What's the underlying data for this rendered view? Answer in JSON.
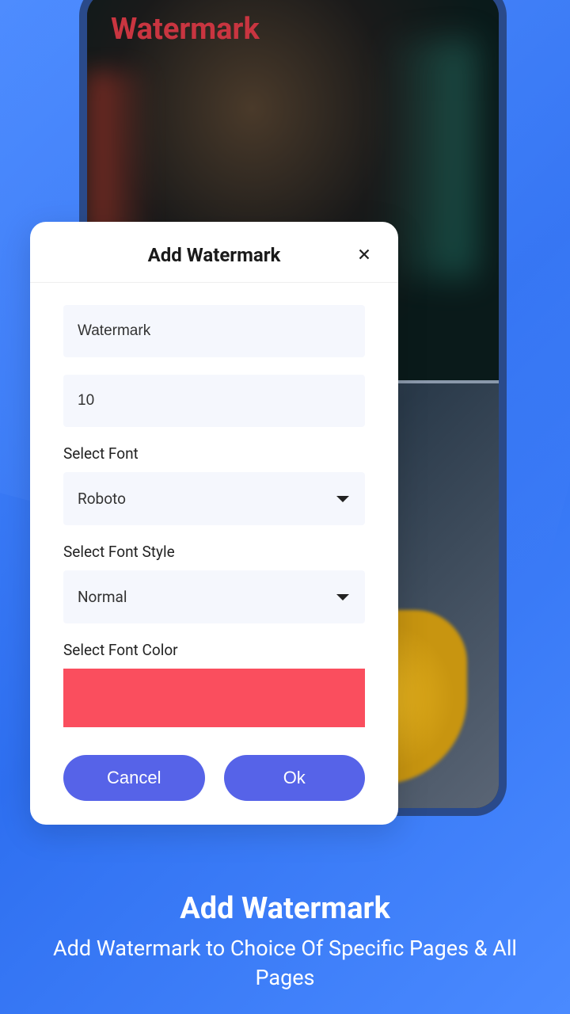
{
  "phone": {
    "watermark_text": "Watermark"
  },
  "dialog": {
    "title": "Add Watermark",
    "watermark_value": "Watermark",
    "size_value": "10",
    "font_label": "Select Font",
    "font_value": "Roboto",
    "style_label": "Select Font Style",
    "style_value": "Normal",
    "color_label": "Select Font Color",
    "color_value": "#fa4e5e",
    "cancel_label": "Cancel",
    "ok_label": "Ok"
  },
  "footer": {
    "title": "Add Watermark",
    "subtitle": "Add Watermark to Choice Of Specific Pages & All Pages"
  }
}
